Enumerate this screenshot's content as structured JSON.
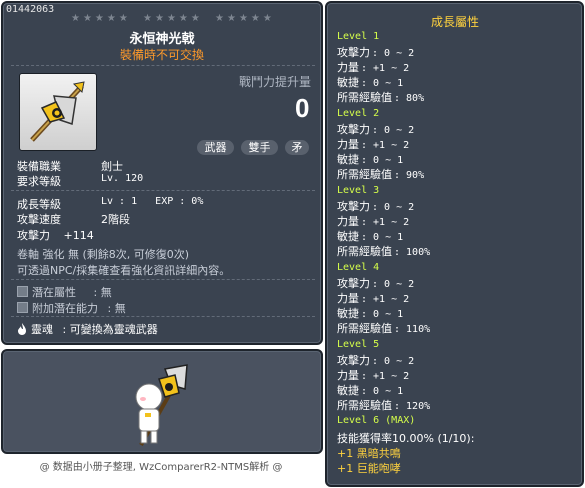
{
  "item": {
    "id": "01442063",
    "stars": [
      "★★★★★",
      "★★★★★",
      "★★★★★"
    ],
    "name": "永恒神光戟",
    "sub": "裝備時不可交換",
    "power_label": "戰鬥力提升量",
    "power_value": "0",
    "tags": [
      "武器",
      "雙手",
      "矛"
    ],
    "info": [
      {
        "k": "裝備職業",
        "v": "劍士"
      },
      {
        "k": "要求等級",
        "v": "Lv. 120"
      }
    ],
    "growth": [
      {
        "k": "成長等級",
        "v": "Lv : 1   EXP : 0%"
      },
      {
        "k": "攻擊速度",
        "v": "2階段"
      }
    ],
    "atk_label": "攻擊力",
    "atk_value": "+114",
    "enhance_line1": "卷軸 強化 無 (剩餘8次, 可修復0次)",
    "enhance_line2": "可透過NPC/採集確查看強化資訊詳細內容。",
    "potential": [
      {
        "k": "潛在屬性",
        "v": ": 無"
      },
      {
        "k": "附加潛在能力",
        "v": ": 無"
      }
    ],
    "soul_label": "靈魂",
    "soul_value": ": 可變換為靈魂武器"
  },
  "watermark": "@ 数据由小册子整理, WzComparerR2-NTMS解析 @",
  "growth_panel": {
    "title": "成長屬性",
    "levels": [
      {
        "title": "Level 1",
        "stats": [
          {
            "k": "攻擊力",
            "v": ": 0 ~ 2"
          },
          {
            "k": "力量",
            "v": ": +1 ~ 2"
          },
          {
            "k": "敏捷",
            "v": ": 0 ~ 1"
          },
          {
            "k": "所需經驗值",
            "v": ": 80%"
          }
        ]
      },
      {
        "title": "Level 2",
        "stats": [
          {
            "k": "攻擊力",
            "v": ": 0 ~ 2"
          },
          {
            "k": "力量",
            "v": ": +1 ~ 2"
          },
          {
            "k": "敏捷",
            "v": ": 0 ~ 1"
          },
          {
            "k": "所需經驗值",
            "v": ": 90%"
          }
        ]
      },
      {
        "title": "Level 3",
        "stats": [
          {
            "k": "攻擊力",
            "v": ": 0 ~ 2"
          },
          {
            "k": "力量",
            "v": ": +1 ~ 2"
          },
          {
            "k": "敏捷",
            "v": ": 0 ~ 1"
          },
          {
            "k": "所需經驗值",
            "v": ": 100%"
          }
        ]
      },
      {
        "title": "Level 4",
        "stats": [
          {
            "k": "攻擊力",
            "v": ": 0 ~ 2"
          },
          {
            "k": "力量",
            "v": ": +1 ~ 2"
          },
          {
            "k": "敏捷",
            "v": ": 0 ~ 1"
          },
          {
            "k": "所需經驗值",
            "v": ": 110%"
          }
        ]
      },
      {
        "title": "Level 5",
        "stats": [
          {
            "k": "攻擊力",
            "v": ": 0 ~ 2"
          },
          {
            "k": "力量",
            "v": ": +1 ~ 2"
          },
          {
            "k": "敏捷",
            "v": ": 0 ~ 1"
          },
          {
            "k": "所需經驗值",
            "v": ": 120%"
          }
        ]
      }
    ],
    "level6_title": "Level 6 (MAX)",
    "skill_rate": "技能獲得率10.00% (1/10):",
    "skills": [
      "+1 黑暗共鳴",
      "+1 巨能咆哮"
    ]
  },
  "colors": {
    "panel": "#3a4350",
    "gold": "#ffd23e",
    "orange": "#ff9a2a",
    "level": "#d6ff4a"
  }
}
